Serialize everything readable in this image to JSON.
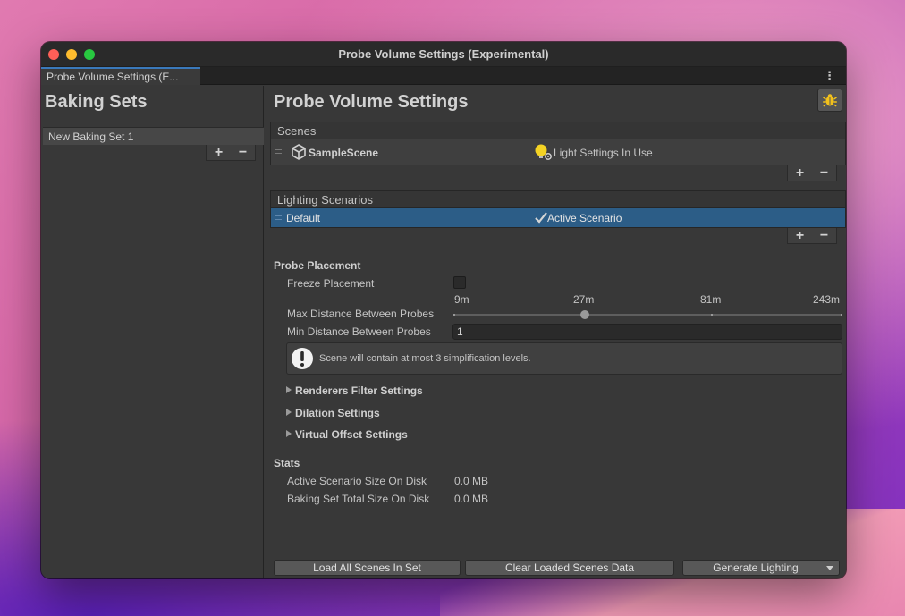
{
  "window": {
    "title": "Probe Volume Settings (Experimental)"
  },
  "tab": {
    "label": "Probe Volume Settings (E..."
  },
  "baking_sets": {
    "title": "Baking Sets",
    "items": [
      {
        "label": "New Baking Set 1"
      }
    ],
    "add_label": "+",
    "remove_label": "−"
  },
  "main": {
    "title": "Probe Volume Settings",
    "scenes": {
      "header": "Scenes",
      "rows": [
        {
          "name": "SampleScene",
          "status": "Light Settings In Use"
        }
      ]
    },
    "lighting_scenarios": {
      "header": "Lighting Scenarios",
      "rows": [
        {
          "name": "Default",
          "status": "Active Scenario"
        }
      ]
    },
    "probe_placement": {
      "header": "Probe Placement",
      "freeze_label": "Freeze Placement",
      "freeze_checked": false,
      "max_distance_label": "Max Distance Between Probes",
      "max_distance_ticks": [
        "9m",
        "27m",
        "81m",
        "243m"
      ],
      "max_distance_value": "27m",
      "min_distance_label": "Min Distance Between Probes",
      "min_distance_value": "1",
      "info_text": "Scene will contain at most 3 simplification levels."
    },
    "foldouts": [
      "Renderers Filter Settings",
      "Dilation Settings",
      "Virtual Offset Settings"
    ],
    "stats": {
      "header": "Stats",
      "active_label": "Active Scenario Size On Disk",
      "active_value": "0.0 MB",
      "total_label": "Baking Set Total Size On Disk",
      "total_value": "0.0 MB"
    },
    "buttons": {
      "load_all": "Load All Scenes In Set",
      "clear_loaded": "Clear Loaded Scenes Data",
      "generate": "Generate Lighting"
    }
  },
  "colors": {
    "window_bg": "#383838",
    "selection": "#2c5d87",
    "tab_accent": "#3a79bb"
  }
}
